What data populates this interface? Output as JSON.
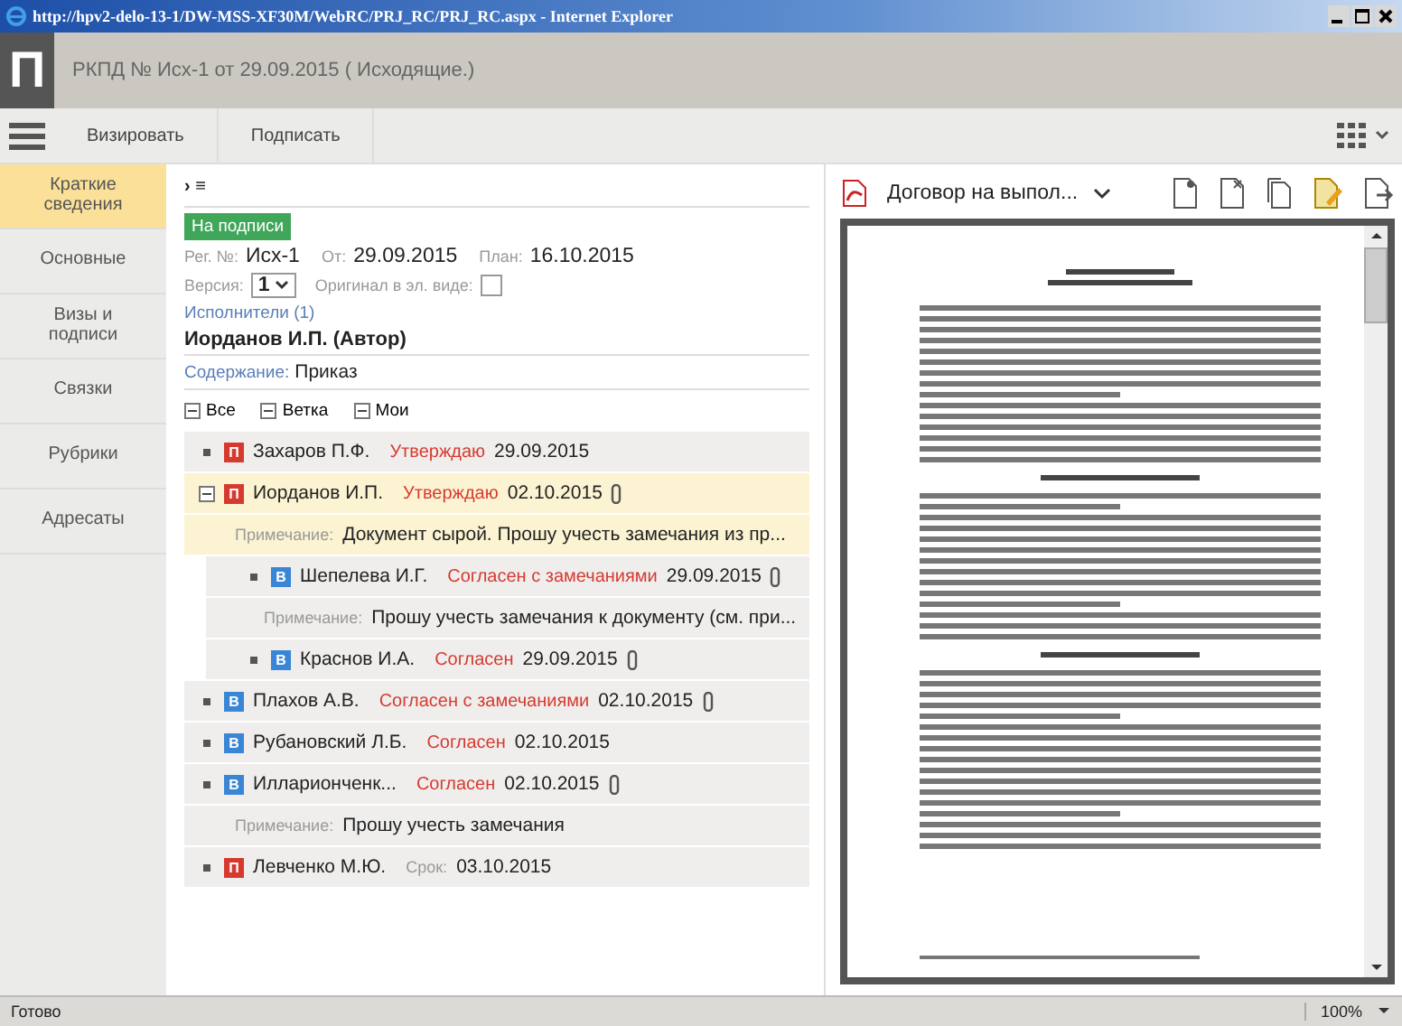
{
  "window": {
    "title": "http://hpv2-delo-13-1/DW-MSS-XF30M/WebRC/PRJ_RC/PRJ_RC.aspx - Internet Explorer"
  },
  "header": {
    "logo": "П",
    "title": "РКПД № Исх-1 от 29.09.2015 ( Исходящие.)"
  },
  "toolbar": {
    "buttons": [
      "Визировать",
      "Подписать"
    ]
  },
  "sidebar": {
    "items": [
      {
        "label": "Краткие сведения",
        "selected": true
      },
      {
        "label": "Основные",
        "selected": false
      },
      {
        "label": "Визы и подписи",
        "selected": false
      },
      {
        "label": "Связки",
        "selected": false
      },
      {
        "label": "Рубрики",
        "selected": false
      },
      {
        "label": "Адресаты",
        "selected": false
      }
    ]
  },
  "breadcrumb": "› ≡",
  "status_badge": "На подписи",
  "reg": {
    "reg_label": "Рег. №:",
    "reg_value": "Исх-1",
    "from_label": "От:",
    "from_value": "29.09.2015",
    "plan_label": "План:",
    "plan_value": "16.10.2015"
  },
  "version": {
    "label": "Версия:",
    "value": "1",
    "original_label": "Оригинал в эл. виде:",
    "original_checked": false
  },
  "executors_link": "Исполнители (1)",
  "author": "Иорданов И.П. (Автор)",
  "content": {
    "label": "Содержание:",
    "value": "Приказ"
  },
  "filters": [
    "Все",
    "Ветка",
    "Мои"
  ],
  "approvals": [
    {
      "expanded": false,
      "letter": "П",
      "color": "#d63a2f",
      "name": "Захаров П.Ф.",
      "kind": "status",
      "status": "Утверждаю",
      "date": "29.09.2015",
      "attachment": false,
      "selected": false
    },
    {
      "expanded": true,
      "letter": "П",
      "color": "#d63a2f",
      "name": "Иорданов И.П.",
      "kind": "status",
      "status": "Утверждаю",
      "date": "02.10.2015",
      "attachment": true,
      "selected": true,
      "note_label": "Примечание:",
      "note": "Документ сырой. Прошу учесть замечания из пр...",
      "children": [
        {
          "expanded": false,
          "letter": "В",
          "color": "#3a86d6",
          "name": "Шепелева И.Г.",
          "kind": "status",
          "status": "Согласен с замечаниями",
          "date": "29.09.2015",
          "attachment": true,
          "selected": false,
          "note_label": "Примечание:",
          "note": "Прошу учесть замечания к документу (см. при..."
        },
        {
          "expanded": false,
          "letter": "В",
          "color": "#3a86d6",
          "name": "Краснов И.А.",
          "kind": "status",
          "status": "Согласен",
          "date": "29.09.2015",
          "attachment": true,
          "selected": false
        }
      ]
    },
    {
      "expanded": false,
      "letter": "В",
      "color": "#3a86d6",
      "name": "Плахов А.В.",
      "kind": "status",
      "status": "Согласен с замечаниями",
      "date": "02.10.2015",
      "attachment": true,
      "selected": false
    },
    {
      "expanded": false,
      "letter": "В",
      "color": "#3a86d6",
      "name": "Рубановский Л.Б.",
      "kind": "status",
      "status": "Согласен",
      "date": "02.10.2015",
      "attachment": false,
      "selected": false
    },
    {
      "expanded": false,
      "letter": "В",
      "color": "#3a86d6",
      "name": "Илларионченк...",
      "kind": "status",
      "status": "Согласен",
      "date": "02.10.2015",
      "attachment": true,
      "selected": false,
      "note_label": "Примечание:",
      "note": "Прошу учесть замечания"
    },
    {
      "expanded": false,
      "letter": "П",
      "color": "#d63a2f",
      "name": "Левченко М.Ю.",
      "kind": "deadline",
      "status": "Срок:",
      "date": "03.10.2015",
      "attachment": false,
      "selected": false
    }
  ],
  "file": {
    "name": "Договор на выпол..."
  },
  "status_bar": {
    "text": "Готово",
    "zoom": "100%"
  }
}
